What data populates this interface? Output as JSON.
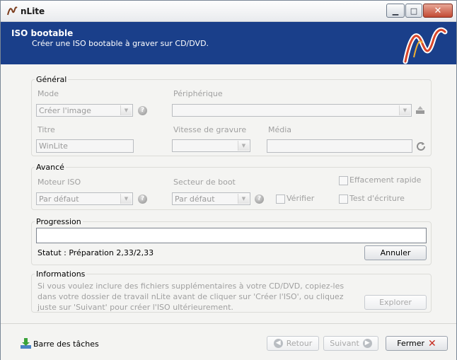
{
  "window": {
    "title": "nLite"
  },
  "header": {
    "title": "ISO bootable",
    "subtitle": "Créer une ISO bootable à graver sur CD/DVD."
  },
  "general": {
    "legend": "Général",
    "mode_label": "Mode",
    "mode_value": "Créer l'image",
    "device_label": "Périphérique",
    "device_value": "",
    "title_label": "Titre",
    "title_value": "WinLite",
    "speed_label": "Vitesse de gravure",
    "speed_value": "",
    "media_label": "Média",
    "media_value": ""
  },
  "advanced": {
    "legend": "Avancé",
    "iso_engine_label": "Moteur ISO",
    "iso_engine_value": "Par défaut",
    "boot_sector_label": "Secteur de boot",
    "boot_sector_value": "Par défaut",
    "quick_erase_label": "Effacement rapide",
    "verify_label": "Vérifier",
    "write_test_label": "Test d'écriture"
  },
  "progress": {
    "legend": "Progression",
    "value_percent": 0,
    "status": "Statut : Préparation 2,33/2,33",
    "cancel_label": "Annuler"
  },
  "info": {
    "legend": "Informations",
    "text": "Si vous voulez inclure des fichiers supplémentaires à votre CD/DVD, copiez-les dans votre dossier de travail nLite avant de cliquer sur 'Créer l'ISO', ou cliquez juste sur 'Suivant' pour créer l'ISO ultérieurement.",
    "explore_label": "Explorer"
  },
  "footer": {
    "taskbar_label": "Barre des tâches",
    "back_label": "Retour",
    "next_label": "Suivant",
    "close_label": "Fermer"
  },
  "colors": {
    "header_bg": "#1a3f8a",
    "close_red": "#c24a33"
  }
}
